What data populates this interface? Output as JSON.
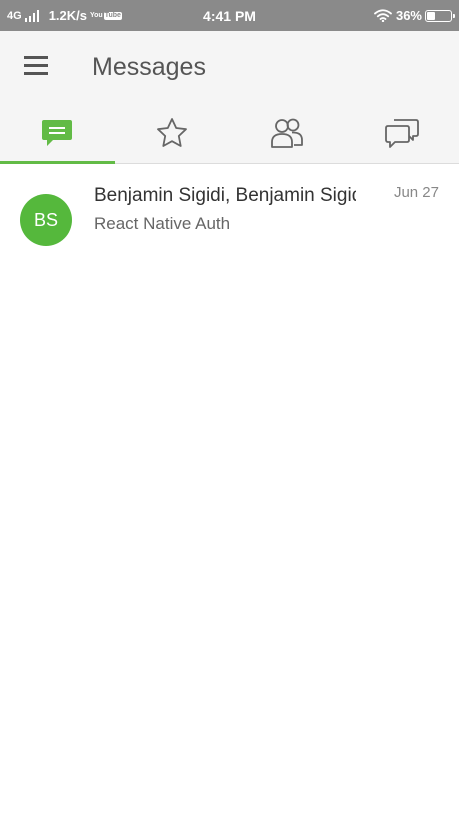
{
  "status_bar": {
    "network": "4G",
    "speed": "1.2K/s",
    "app_icon_label": "You",
    "app_icon_label2": "Tube",
    "time": "4:41 PM",
    "battery": "36%"
  },
  "app_bar": {
    "title": "Messages",
    "menu_icon": "hamburger-menu-icon"
  },
  "tabs": [
    {
      "icon": "chat-bubble-icon",
      "active": true
    },
    {
      "icon": "star-icon",
      "active": false
    },
    {
      "icon": "people-icon",
      "active": false
    },
    {
      "icon": "conversations-icon",
      "active": false
    }
  ],
  "colors": {
    "accent": "#62bb46",
    "avatar": "#55b83c",
    "status_bar": "#8a8a8a",
    "app_bar": "#f5f5f5"
  },
  "messages": [
    {
      "initials": "BS",
      "name": "Benjamin Sigidi, Benjamin Sigidi",
      "preview": "React Native Auth",
      "date": "Jun 27"
    }
  ]
}
